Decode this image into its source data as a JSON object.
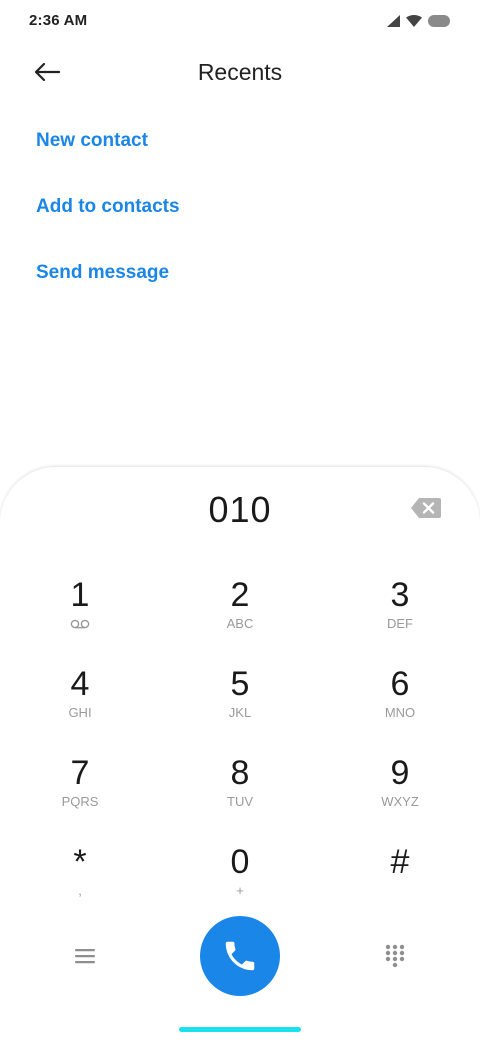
{
  "status_bar": {
    "time": "2:36 AM"
  },
  "header": {
    "title": "Recents"
  },
  "actions": [
    {
      "label": "New contact"
    },
    {
      "label": "Add to contacts"
    },
    {
      "label": "Send message"
    }
  ],
  "dialer": {
    "number": "010",
    "keys": [
      {
        "digit": "1",
        "sub": ""
      },
      {
        "digit": "2",
        "sub": "ABC"
      },
      {
        "digit": "3",
        "sub": "DEF"
      },
      {
        "digit": "4",
        "sub": "GHI"
      },
      {
        "digit": "5",
        "sub": "JKL"
      },
      {
        "digit": "6",
        "sub": "MNO"
      },
      {
        "digit": "7",
        "sub": "PQRS"
      },
      {
        "digit": "8",
        "sub": "TUV"
      },
      {
        "digit": "9",
        "sub": "WXYZ"
      },
      {
        "digit": "*",
        "sub": ","
      },
      {
        "digit": "0",
        "sub": "+"
      },
      {
        "digit": "#",
        "sub": ""
      }
    ]
  },
  "colors": {
    "accent": "#1a86e8",
    "home_indicator": "#19e1ee"
  },
  "icons": [
    "back-arrow-icon",
    "backspace-icon",
    "voicemail-icon",
    "menu-icon",
    "phone-icon",
    "dialpad-icon",
    "signal-icon",
    "wifi-icon",
    "battery-icon"
  ]
}
